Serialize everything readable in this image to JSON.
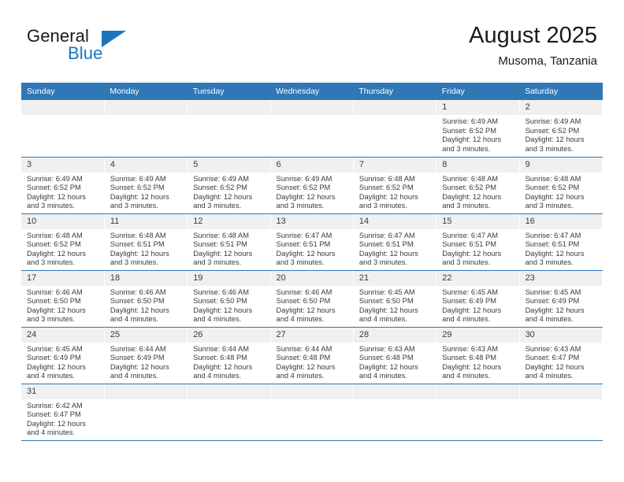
{
  "brand": {
    "word_general": "General",
    "word_blue": "Blue",
    "triangle_color": "#1c75bc"
  },
  "header": {
    "title": "August 2025",
    "subtitle": "Musoma, Tanzania"
  },
  "theme": {
    "header_blue": "#2f77b5",
    "daynum_bg": "#f0f0f0",
    "text": "#3a3a3a"
  },
  "weekdays": [
    "Sunday",
    "Monday",
    "Tuesday",
    "Wednesday",
    "Thursday",
    "Friday",
    "Saturday"
  ],
  "weeks": [
    [
      {
        "day": "",
        "empty": true
      },
      {
        "day": "",
        "empty": true
      },
      {
        "day": "",
        "empty": true
      },
      {
        "day": "",
        "empty": true
      },
      {
        "day": "",
        "empty": true
      },
      {
        "day": "1",
        "sunrise": "Sunrise: 6:49 AM",
        "sunset": "Sunset: 6:52 PM",
        "daylight1": "Daylight: 12 hours",
        "daylight2": "and 3 minutes."
      },
      {
        "day": "2",
        "sunrise": "Sunrise: 6:49 AM",
        "sunset": "Sunset: 6:52 PM",
        "daylight1": "Daylight: 12 hours",
        "daylight2": "and 3 minutes."
      }
    ],
    [
      {
        "day": "3",
        "sunrise": "Sunrise: 6:49 AM",
        "sunset": "Sunset: 6:52 PM",
        "daylight1": "Daylight: 12 hours",
        "daylight2": "and 3 minutes."
      },
      {
        "day": "4",
        "sunrise": "Sunrise: 6:49 AM",
        "sunset": "Sunset: 6:52 PM",
        "daylight1": "Daylight: 12 hours",
        "daylight2": "and 3 minutes."
      },
      {
        "day": "5",
        "sunrise": "Sunrise: 6:49 AM",
        "sunset": "Sunset: 6:52 PM",
        "daylight1": "Daylight: 12 hours",
        "daylight2": "and 3 minutes."
      },
      {
        "day": "6",
        "sunrise": "Sunrise: 6:49 AM",
        "sunset": "Sunset: 6:52 PM",
        "daylight1": "Daylight: 12 hours",
        "daylight2": "and 3 minutes."
      },
      {
        "day": "7",
        "sunrise": "Sunrise: 6:48 AM",
        "sunset": "Sunset: 6:52 PM",
        "daylight1": "Daylight: 12 hours",
        "daylight2": "and 3 minutes."
      },
      {
        "day": "8",
        "sunrise": "Sunrise: 6:48 AM",
        "sunset": "Sunset: 6:52 PM",
        "daylight1": "Daylight: 12 hours",
        "daylight2": "and 3 minutes."
      },
      {
        "day": "9",
        "sunrise": "Sunrise: 6:48 AM",
        "sunset": "Sunset: 6:52 PM",
        "daylight1": "Daylight: 12 hours",
        "daylight2": "and 3 minutes."
      }
    ],
    [
      {
        "day": "10",
        "sunrise": "Sunrise: 6:48 AM",
        "sunset": "Sunset: 6:52 PM",
        "daylight1": "Daylight: 12 hours",
        "daylight2": "and 3 minutes."
      },
      {
        "day": "11",
        "sunrise": "Sunrise: 6:48 AM",
        "sunset": "Sunset: 6:51 PM",
        "daylight1": "Daylight: 12 hours",
        "daylight2": "and 3 minutes."
      },
      {
        "day": "12",
        "sunrise": "Sunrise: 6:48 AM",
        "sunset": "Sunset: 6:51 PM",
        "daylight1": "Daylight: 12 hours",
        "daylight2": "and 3 minutes."
      },
      {
        "day": "13",
        "sunrise": "Sunrise: 6:47 AM",
        "sunset": "Sunset: 6:51 PM",
        "daylight1": "Daylight: 12 hours",
        "daylight2": "and 3 minutes."
      },
      {
        "day": "14",
        "sunrise": "Sunrise: 6:47 AM",
        "sunset": "Sunset: 6:51 PM",
        "daylight1": "Daylight: 12 hours",
        "daylight2": "and 3 minutes."
      },
      {
        "day": "15",
        "sunrise": "Sunrise: 6:47 AM",
        "sunset": "Sunset: 6:51 PM",
        "daylight1": "Daylight: 12 hours",
        "daylight2": "and 3 minutes."
      },
      {
        "day": "16",
        "sunrise": "Sunrise: 6:47 AM",
        "sunset": "Sunset: 6:51 PM",
        "daylight1": "Daylight: 12 hours",
        "daylight2": "and 3 minutes."
      }
    ],
    [
      {
        "day": "17",
        "sunrise": "Sunrise: 6:46 AM",
        "sunset": "Sunset: 6:50 PM",
        "daylight1": "Daylight: 12 hours",
        "daylight2": "and 3 minutes."
      },
      {
        "day": "18",
        "sunrise": "Sunrise: 6:46 AM",
        "sunset": "Sunset: 6:50 PM",
        "daylight1": "Daylight: 12 hours",
        "daylight2": "and 4 minutes."
      },
      {
        "day": "19",
        "sunrise": "Sunrise: 6:46 AM",
        "sunset": "Sunset: 6:50 PM",
        "daylight1": "Daylight: 12 hours",
        "daylight2": "and 4 minutes."
      },
      {
        "day": "20",
        "sunrise": "Sunrise: 6:46 AM",
        "sunset": "Sunset: 6:50 PM",
        "daylight1": "Daylight: 12 hours",
        "daylight2": "and 4 minutes."
      },
      {
        "day": "21",
        "sunrise": "Sunrise: 6:45 AM",
        "sunset": "Sunset: 6:50 PM",
        "daylight1": "Daylight: 12 hours",
        "daylight2": "and 4 minutes."
      },
      {
        "day": "22",
        "sunrise": "Sunrise: 6:45 AM",
        "sunset": "Sunset: 6:49 PM",
        "daylight1": "Daylight: 12 hours",
        "daylight2": "and 4 minutes."
      },
      {
        "day": "23",
        "sunrise": "Sunrise: 6:45 AM",
        "sunset": "Sunset: 6:49 PM",
        "daylight1": "Daylight: 12 hours",
        "daylight2": "and 4 minutes."
      }
    ],
    [
      {
        "day": "24",
        "sunrise": "Sunrise: 6:45 AM",
        "sunset": "Sunset: 6:49 PM",
        "daylight1": "Daylight: 12 hours",
        "daylight2": "and 4 minutes."
      },
      {
        "day": "25",
        "sunrise": "Sunrise: 6:44 AM",
        "sunset": "Sunset: 6:49 PM",
        "daylight1": "Daylight: 12 hours",
        "daylight2": "and 4 minutes."
      },
      {
        "day": "26",
        "sunrise": "Sunrise: 6:44 AM",
        "sunset": "Sunset: 6:48 PM",
        "daylight1": "Daylight: 12 hours",
        "daylight2": "and 4 minutes."
      },
      {
        "day": "27",
        "sunrise": "Sunrise: 6:44 AM",
        "sunset": "Sunset: 6:48 PM",
        "daylight1": "Daylight: 12 hours",
        "daylight2": "and 4 minutes."
      },
      {
        "day": "28",
        "sunrise": "Sunrise: 6:43 AM",
        "sunset": "Sunset: 6:48 PM",
        "daylight1": "Daylight: 12 hours",
        "daylight2": "and 4 minutes."
      },
      {
        "day": "29",
        "sunrise": "Sunrise: 6:43 AM",
        "sunset": "Sunset: 6:48 PM",
        "daylight1": "Daylight: 12 hours",
        "daylight2": "and 4 minutes."
      },
      {
        "day": "30",
        "sunrise": "Sunrise: 6:43 AM",
        "sunset": "Sunset: 6:47 PM",
        "daylight1": "Daylight: 12 hours",
        "daylight2": "and 4 minutes."
      }
    ],
    [
      {
        "day": "31",
        "sunrise": "Sunrise: 6:42 AM",
        "sunset": "Sunset: 6:47 PM",
        "daylight1": "Daylight: 12 hours",
        "daylight2": "and 4 minutes."
      },
      {
        "day": "",
        "empty": true
      },
      {
        "day": "",
        "empty": true
      },
      {
        "day": "",
        "empty": true
      },
      {
        "day": "",
        "empty": true
      },
      {
        "day": "",
        "empty": true
      },
      {
        "day": "",
        "empty": true
      }
    ]
  ]
}
